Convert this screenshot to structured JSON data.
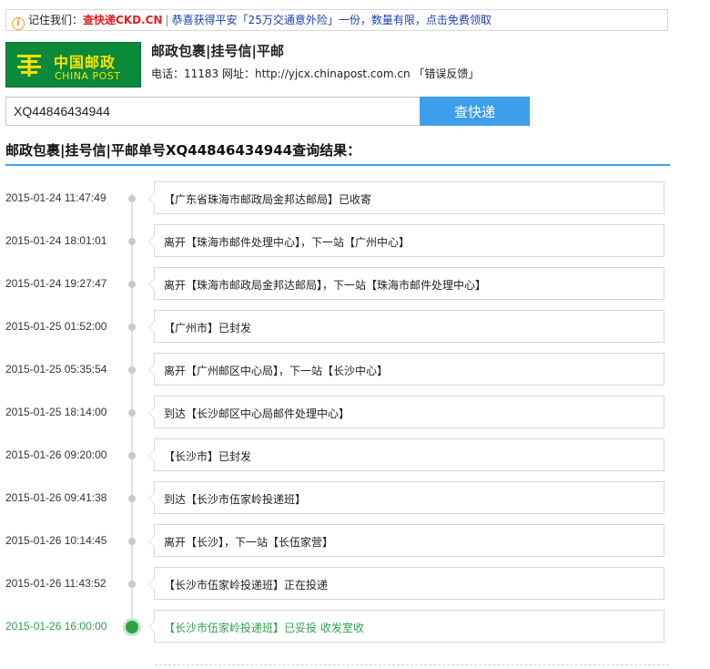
{
  "notice": {
    "remember_label": "记住我们：",
    "brand": "查快递",
    "domain": "CKD.CN",
    "separator": "|",
    "promo": "恭喜获得平安「25万交通意外险」一份，数量有限，点击免费领取"
  },
  "carrier": {
    "logo_cn": "中国邮政",
    "logo_en": "CHINA POST",
    "title": "邮政包裹|挂号信|平邮",
    "contact": "电话：11183 网址：http://yjcx.chinapost.com.cn 「错误反馈」"
  },
  "search": {
    "value": "XQ44846434944",
    "button_label": "查快递"
  },
  "result_title": "邮政包裹|挂号信|平邮单号XQ44846434944查询结果：",
  "colors": {
    "accent": "#3d9fea",
    "current_status": "#2ea24b",
    "logo_bg": "#0a8a3a",
    "logo_text": "#ffe000"
  },
  "events": [
    {
      "time": "2015-01-24 11:47:49",
      "text": "【广东省珠海市邮政局金邦达邮局】已收寄"
    },
    {
      "time": "2015-01-24 18:01:01",
      "text": "离开【珠海市邮件处理中心】，下一站【广州中心】"
    },
    {
      "time": "2015-01-24 19:27:47",
      "text": "离开【珠海市邮政局金邦达邮局】，下一站【珠海市邮件处理中心】"
    },
    {
      "time": "2015-01-25 01:52:00",
      "text": "【广州市】已封发"
    },
    {
      "time": "2015-01-25 05:35:54",
      "text": "离开【广州邮区中心局】，下一站【长沙中心】"
    },
    {
      "time": "2015-01-25 18:14:00",
      "text": "到达【长沙邮区中心局邮件处理中心】"
    },
    {
      "time": "2015-01-26 09:20:00",
      "text": "【长沙市】已封发"
    },
    {
      "time": "2015-01-26 09:41:38",
      "text": "到达【长沙市伍家岭投递班】"
    },
    {
      "time": "2015-01-26 10:14:45",
      "text": "离开【长沙】，下一站【长伍家营】"
    },
    {
      "time": "2015-01-26 11:43:52",
      "text": "【长沙市伍家岭投递班】正在投递"
    },
    {
      "time": "2015-01-26 16:00:00",
      "text": "【长沙市伍家岭投递班】已妥投 收发室收",
      "current": true
    }
  ]
}
